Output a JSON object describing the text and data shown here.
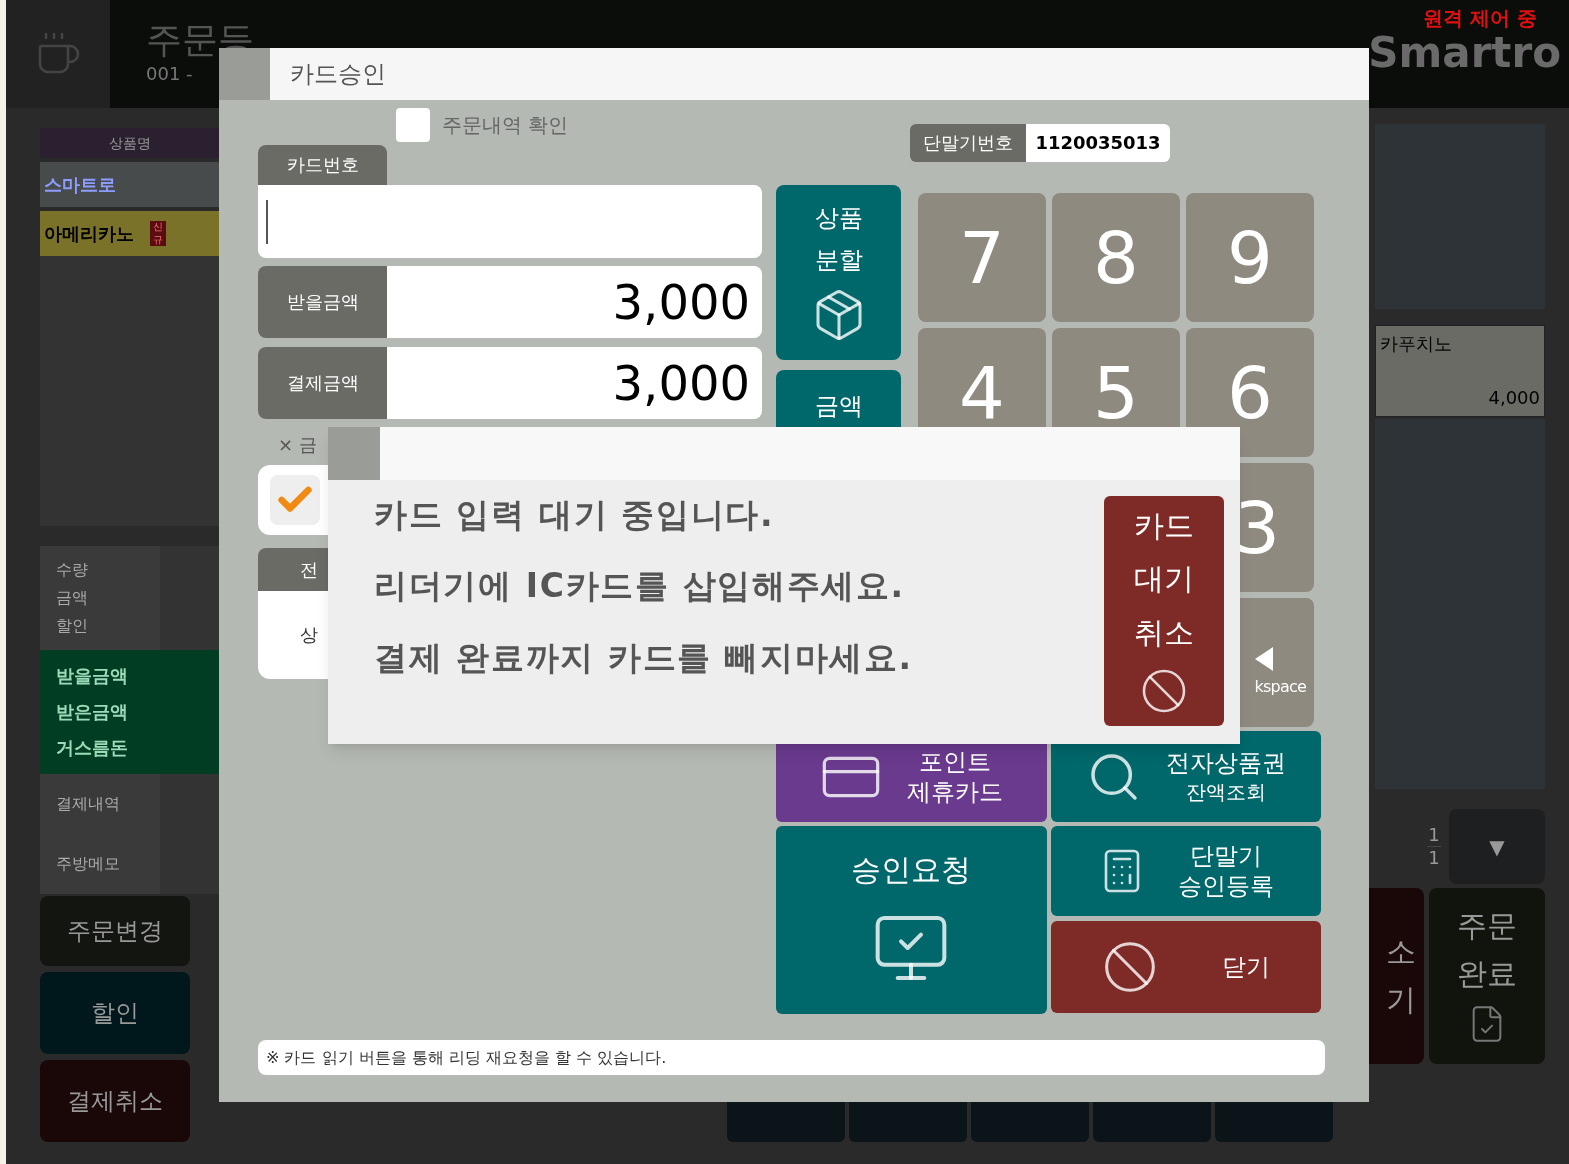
{
  "background": {
    "remote_status": "원격 제어 중",
    "brand": "Smartro",
    "header_title": "주문등",
    "header_sub": "001 -",
    "item_table": {
      "header": "상품명",
      "rows": [
        {
          "name": "스마트로",
          "kind": "category"
        },
        {
          "name": "아메리카노",
          "kind": "product",
          "badge": "신규"
        }
      ]
    },
    "summary_labels": [
      "수량",
      "금액",
      "할인"
    ],
    "payment_labels": [
      "받을금액",
      "받은금액",
      "거스름돈"
    ],
    "extra_labels": [
      "결제내역",
      "주방메모"
    ],
    "left_buttons": [
      {
        "label": "주문변경",
        "color": "#131510"
      },
      {
        "label": "할인",
        "color": "#00171c"
      },
      {
        "label": "결제취소",
        "color": "#1a0808"
      }
    ],
    "menu_item": {
      "name": "카푸치노",
      "price": "4,000"
    },
    "pager": {
      "current": "1",
      "total": "1",
      "next": "▼"
    },
    "right_buttons": [
      {
        "label": "소\n기",
        "color": "#1a0808"
      },
      {
        "label": "주문\n완료",
        "color": "#10140c"
      }
    ]
  },
  "dialog": {
    "title": "카드승인",
    "order_check": {
      "label": "주문내역 확인",
      "checked": false
    },
    "terminal": {
      "label": "단말기번호",
      "value": "1120035013"
    },
    "card_tab": "카드번호",
    "amounts": [
      {
        "label": "받을금액",
        "value": "3,000"
      },
      {
        "label": "결제금액",
        "value": "3,000"
      }
    ],
    "note_fragment": "× 금",
    "card_check": {
      "checked": true
    },
    "section_tab": "전",
    "section_text": "상",
    "side_buttons": [
      {
        "label": "상품\n분할",
        "kind": "split"
      },
      {
        "label": "금액",
        "kind": "plain"
      }
    ],
    "keypad": [
      [
        "7",
        "8",
        "9"
      ],
      [
        "4",
        "5",
        "6"
      ]
    ],
    "partial_keys": [
      {
        "kind": "digit",
        "label": "3"
      },
      {
        "kind": "backspace",
        "label": "kspace"
      }
    ],
    "action_buttons": [
      {
        "label": "포인트\n제휴카드",
        "kind": "point",
        "color": "#6a3a8e"
      },
      {
        "label": "전자상품권",
        "sub": "잔액조회",
        "kind": "search",
        "color": "#00676b"
      },
      {
        "label": "승인요청",
        "kind": "approve",
        "color": "#00676b"
      },
      {
        "label": "단말기\n승인등록",
        "kind": "terminal",
        "color": "#00676b"
      },
      {
        "label": "닫기",
        "kind": "close",
        "color": "#7e2a27"
      }
    ],
    "footer_note": "※ 카드 읽기 버튼을 통해 리딩 재요청을 할 수 있습니다."
  },
  "popup": {
    "lines": [
      "카드 입력 대기 중입니다.",
      "리더기에 IC카드를 삽입해주세요.",
      "결제 완료까지 카드를 빼지마세요."
    ],
    "cancel_button": "카드\n대기\n취소"
  }
}
